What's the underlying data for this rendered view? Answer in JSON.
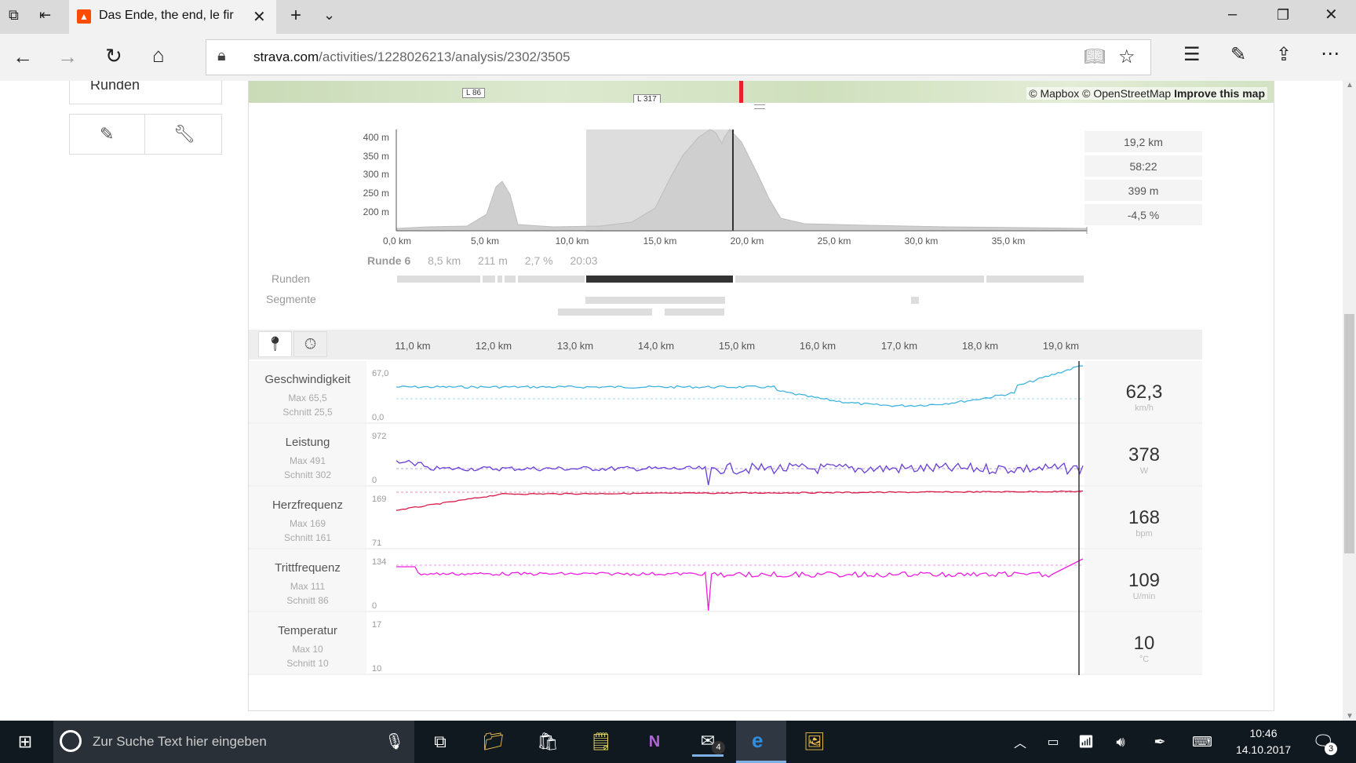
{
  "browser": {
    "tab_title": "Das Ende, the end, le fir",
    "url_domain": "strava.com",
    "url_path": "/activities/1228026213/analysis/2302/3505"
  },
  "map": {
    "attribution_mapbox": "© Mapbox",
    "attribution_osm": "© OpenStreetMap",
    "improve_link": "Improve this map",
    "road_labels": [
      "L 86",
      "L 317"
    ]
  },
  "sidebar": {
    "runden_label": "Runden"
  },
  "elevation": {
    "y_ticks": [
      "400 m",
      "350 m",
      "300 m",
      "250 m",
      "200 m"
    ],
    "x_ticks": [
      "0,0 km",
      "5,0 km",
      "10,0 km",
      "15,0 km",
      "20,0 km",
      "25,0 km",
      "30,0 km",
      "35,0 km"
    ],
    "stats": [
      "19,2 km",
      "58:22",
      "399 m",
      "-4,5 %"
    ],
    "lap_info": {
      "name": "Runde 6",
      "distance": "8,5 km",
      "elevation": "211 m",
      "grade": "2,7 %",
      "time": "20:03"
    },
    "row_runden": "Runden",
    "row_segmente": "Segmente"
  },
  "streams": {
    "x_ticks": [
      "11,0 km",
      "12,0 km",
      "13,0 km",
      "14,0 km",
      "15,0 km",
      "16,0 km",
      "17,0 km",
      "18,0 km",
      "19,0 km"
    ],
    "metrics": [
      {
        "name": "Geschwindigkeit",
        "max": "Max 65,5",
        "avg": "Schnitt 25,5",
        "ymax": "67,0",
        "ymin": "0,0",
        "value": "62,3",
        "unit": "km/h",
        "color": "#3fb3e0"
      },
      {
        "name": "Leistung",
        "max": "Max 491",
        "avg": "Schnitt 302",
        "ymax": "972",
        "ymin": "0",
        "value": "378",
        "unit": "W",
        "color": "#6a3fd6"
      },
      {
        "name": "Herzfrequenz",
        "max": "Max 169",
        "avg": "Schnitt 161",
        "ymax": "169",
        "ymin": "71",
        "value": "168",
        "unit": "bpm",
        "color": "#d81b4a"
      },
      {
        "name": "Trittfrequenz",
        "max": "Max 111",
        "avg": "Schnitt 86",
        "ymax": "134",
        "ymin": "0",
        "value": "109",
        "unit": "U/min",
        "color": "#ee1ee0"
      },
      {
        "name": "Temperatur",
        "max": "Max 10",
        "avg": "Schnitt 10",
        "ymax": "17",
        "ymin": "10",
        "value": "10",
        "unit": "°C",
        "color": "#888888"
      }
    ]
  },
  "taskbar": {
    "search_placeholder": "Zur Suche Text hier eingeben",
    "time": "10:46",
    "date": "14.10.2017",
    "mail_badge": "4",
    "notif_badge": "3"
  }
}
